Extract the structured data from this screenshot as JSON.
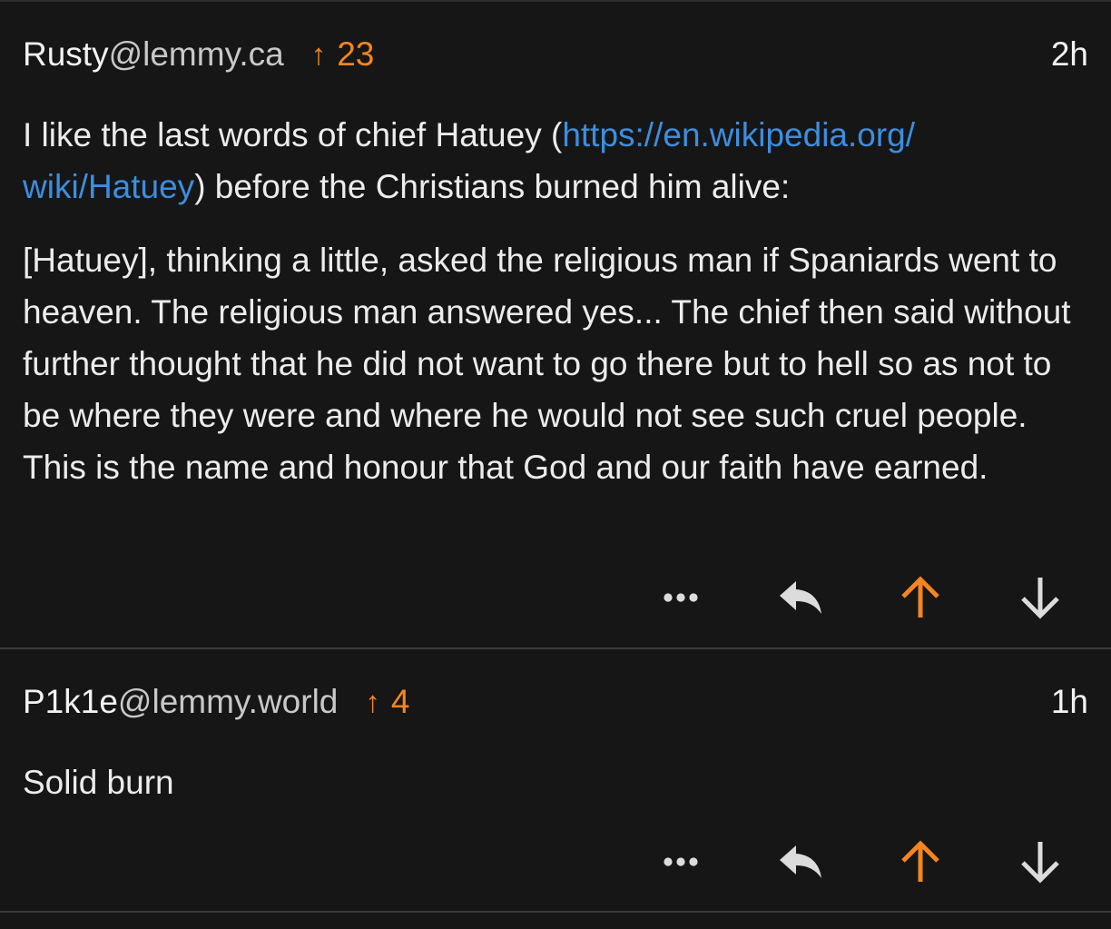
{
  "colors": {
    "background": "#161616",
    "accent_orange": "#f4851f",
    "link_blue": "#3c8ee0",
    "text": "#ececec"
  },
  "comments": [
    {
      "user": "Rusty",
      "instance": "@lemmy.ca",
      "score_arrow": "↑",
      "score": "23",
      "time": "2h",
      "paragraph_1": {
        "pre": "I like the last words of chief Hatuey (",
        "link": "https://en.wikipedia.org/wiki/Hatuey",
        "link_line1": "https://en.wikipedia.org/",
        "link_line2": "wiki/Hatuey",
        "post": ") before the Christians burned him alive:"
      },
      "paragraph_2": "[Hatuey], thinking a little, asked the religious man if Spaniards went to heaven. The religious man answered yes... The chief then said without further thought that he did not want to go there but to hell so as not to be where they were and where he would not see such cruel people. This is the name and honour that God and our faith have earned.",
      "actions": [
        "more-icon",
        "reply-icon",
        "upvote-icon",
        "downvote-icon"
      ],
      "upvoted": true
    },
    {
      "user": "P1k1e",
      "instance": "@lemmy.world",
      "score_arrow": "↑",
      "score": "4",
      "time": "1h",
      "paragraph_1": "Solid burn",
      "actions": [
        "more-icon",
        "reply-icon",
        "upvote-icon",
        "downvote-icon"
      ],
      "upvoted": true
    }
  ]
}
